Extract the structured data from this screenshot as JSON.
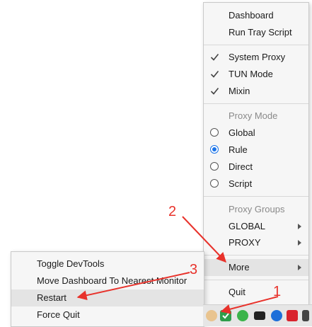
{
  "main_menu": {
    "items": {
      "dashboard": "Dashboard",
      "run_tray_script": "Run Tray Script",
      "system_proxy": "System Proxy",
      "tun_mode": "TUN Mode",
      "mixin": "Mixin",
      "proxy_mode_header": "Proxy Mode",
      "global": "Global",
      "rule": "Rule",
      "direct": "Direct",
      "script": "Script",
      "proxy_groups_header": "Proxy Groups",
      "group_global": "GLOBAL",
      "group_proxy": "PROXY",
      "more": "More",
      "quit": "Quit"
    },
    "checked": [
      "system_proxy",
      "tun_mode",
      "mixin"
    ],
    "selected_proxy_mode": "Rule"
  },
  "sub_menu": {
    "items": {
      "toggle_devtools": "Toggle DevTools",
      "move_dashboard": "Move Dashboard To Nearest Monitor",
      "restart": "Restart",
      "force_quit": "Force Quit"
    },
    "highlighted": "Restart"
  },
  "annotations": {
    "step1": "1",
    "step2": "2",
    "step3": "3",
    "color": "#e8322b"
  },
  "tray_icons": [
    "clash-cat-icon",
    "shield-check-icon",
    "wechat-icon",
    "battery-icon",
    "security-icon",
    "youdao-icon",
    "volume-icon"
  ]
}
